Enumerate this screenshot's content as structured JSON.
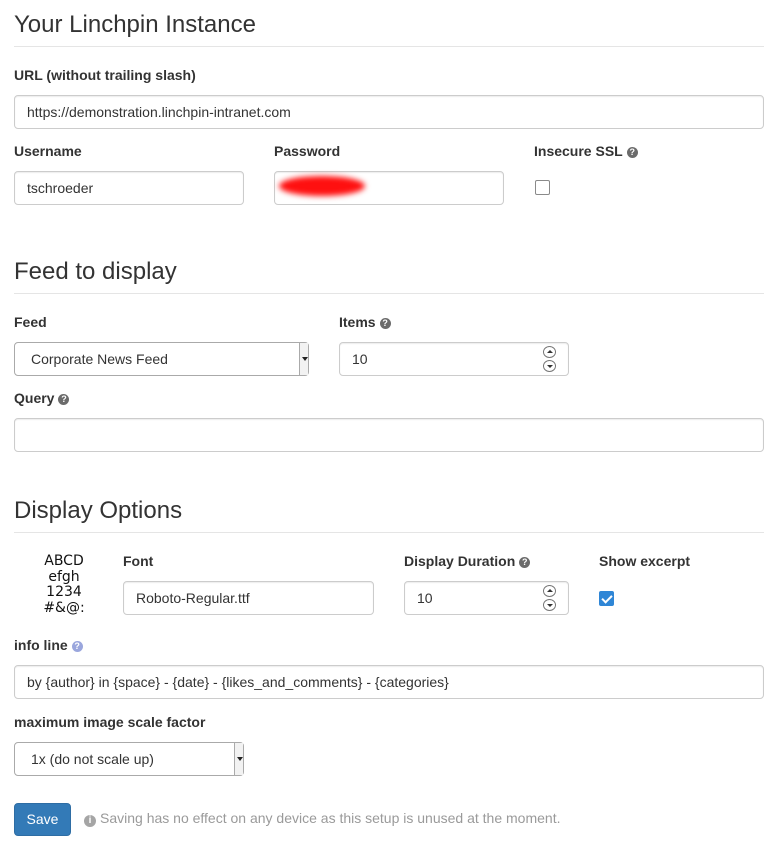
{
  "instance": {
    "heading": "Your Linchpin Instance",
    "url_label": "URL (without trailing slash)",
    "url_value": "https://demonstration.linchpin-intranet.com",
    "username_label": "Username",
    "username_value": "tschroeder",
    "password_label": "Password",
    "insecure_label": "Insecure SSL",
    "insecure_checked": false
  },
  "feed": {
    "heading": "Feed to display",
    "feed_label": "Feed",
    "feed_selected": "Corporate News Feed",
    "items_label": "Items",
    "items_value": "10",
    "query_label": "Query",
    "query_value": ""
  },
  "display": {
    "heading": "Display Options",
    "font_preview": [
      "ABCD",
      "efgh",
      "1234",
      "#&@:"
    ],
    "font_label": "Font",
    "font_value": "Roboto-Regular.ttf",
    "duration_label": "Display Duration",
    "duration_value": "10",
    "excerpt_label": "Show excerpt",
    "excerpt_checked": true,
    "info_label": "info line",
    "info_value": "by {author} in {space} - {date} - {likes_and_comments} - {categories}",
    "scale_label": "maximum image scale factor",
    "scale_selected": "1x (do not scale up)"
  },
  "footer": {
    "save_label": "Save",
    "note": "Saving has no effect on any device as this setup is unused at the moment."
  },
  "icons": {
    "help": "question-circle-icon",
    "info": "info-circle-icon"
  },
  "colors": {
    "primary": "#337ab7",
    "checkbox_checked": "#2f86d6",
    "help_icon": "#6b6b6b",
    "help_icon_blue": "#9aa6dd",
    "note_text": "#9a9a9a"
  }
}
